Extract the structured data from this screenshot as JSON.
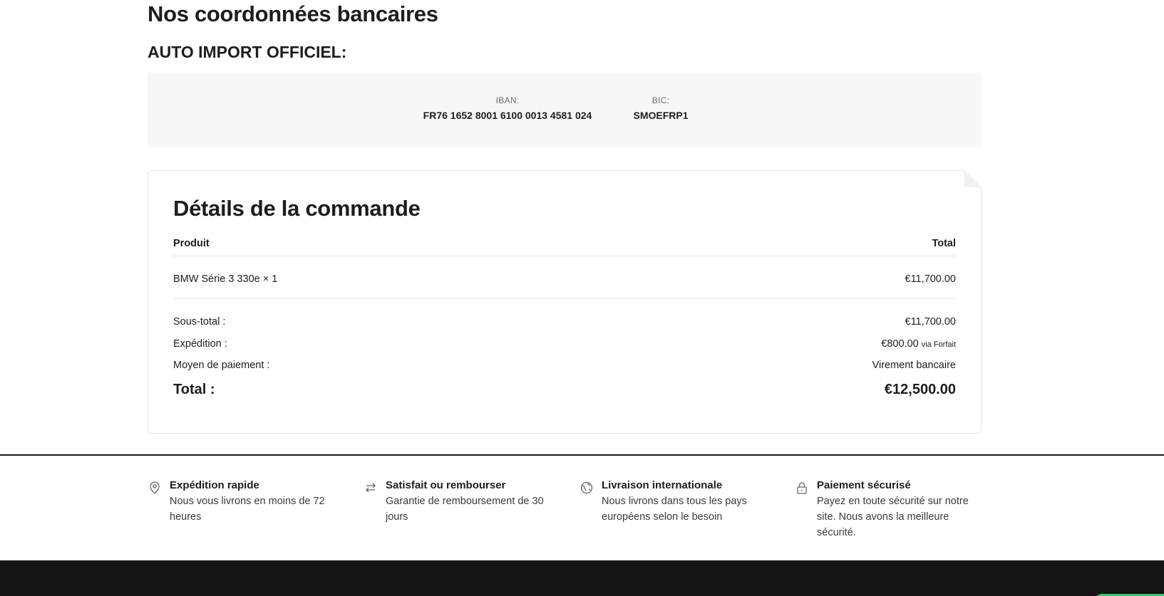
{
  "bank": {
    "title": "Nos coordonnées bancaires",
    "company": "AUTO IMPORT OFFICIEL:",
    "iban_label": "IBAN:",
    "iban_value": "FR76 1652 8001 6100 0013 4581 024",
    "bic_label": "BIC:",
    "bic_value": "SMOEFRP1"
  },
  "order": {
    "title": "Détails de la commande",
    "col_product": "Produit",
    "col_total": "Total",
    "item_name": "BMW Série 3 330e × 1",
    "item_total": "€11,700.00",
    "subtotal_label": "Sous-total :",
    "subtotal_value": "€11,700.00",
    "shipping_label": "Expédition :",
    "shipping_value": "€800.00",
    "shipping_method": "via Forfait",
    "payment_label": "Moyen de paiement :",
    "payment_value": "Virement bancaire",
    "total_label": "Total :",
    "total_value": "€12,500.00"
  },
  "features": [
    {
      "icon": "location-pin-icon",
      "title": "Expédition rapide",
      "desc": "Nous vous livrons en moins de 72 heures"
    },
    {
      "icon": "arrows-exchange-icon",
      "title": "Satisfait ou rembourser",
      "desc": "Garantie de remboursement de 30 jours"
    },
    {
      "icon": "globe-icon",
      "title": "Livraison internationale",
      "desc": "Nous livrons dans tous les pays européens selon le besoin"
    },
    {
      "icon": "lock-icon",
      "title": "Paiement sécurisé",
      "desc": "Payez en toute sécurité sur notre site. Nous avons la meilleure sécurité."
    }
  ],
  "colors": {
    "footer_bar": "#141414",
    "bank_box": "#f7f7f7",
    "text": "#1d1d1d"
  }
}
